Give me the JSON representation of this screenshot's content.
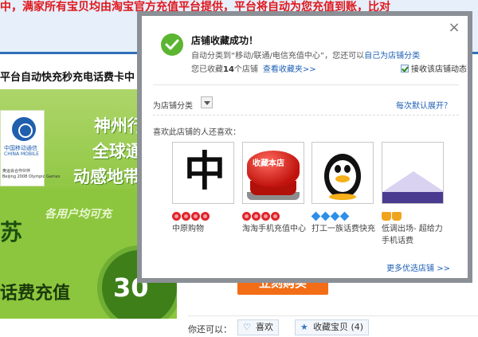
{
  "background": {
    "top_notice": "中，满家所有宝贝均由淘宝官方充值平台提供，平台将自动为您充值到账，比对",
    "product_title": "平台自动快充秒充电话费卡中",
    "banner": {
      "logo_cn": "中国移动通信",
      "logo_en": "CHINA MOBILE",
      "logo_sub1": "奥运会合作伙伴",
      "logo_sub2": "Beijing 2008 Olympic Games",
      "line1": "神州行",
      "line2": "全球通",
      "line3": "动感地带",
      "slogan": "各用户均可充",
      "province": "苏",
      "charge_text": "话费充值",
      "amount": "30"
    },
    "buy_button": "立刻购买",
    "action_label": "你还可以：",
    "like_button": "喜欢",
    "collect_button": "收藏宝贝 (4)"
  },
  "popup": {
    "title": "店铺收藏成功！",
    "auto_class_prefix": "自动分类到",
    "auto_class_name": "“移动/联通/电信充值中心”",
    "auto_class_mid": "，您还可以",
    "auto_class_link": "自己为店铺分类",
    "count_prefix": "您已收藏",
    "count_value": "14",
    "count_suffix": "个店铺",
    "view_link": "查看收藏夹>>",
    "subscribe_label": "接收该店铺动态",
    "category_label": "为店铺分类",
    "expand_link": "每次默认展开？",
    "also_like_title": "喜欢此店铺的人还喜欢：",
    "shops": [
      {
        "name": "中原购物",
        "rating": "heart",
        "count": 4
      },
      {
        "name": "淘淘手机充值中心",
        "rating": "heart",
        "count": 4
      },
      {
        "name": "打工一族话费快充",
        "rating": "diamond",
        "count": 4
      },
      {
        "name": "低调出场- 超给力手机话费",
        "rating": "crown",
        "count": 2
      }
    ],
    "thumb_text": {
      "zhong": "中",
      "red_button": "收藏本店"
    },
    "more_link": "更多优选店铺 >>",
    "close_symbol": "×"
  },
  "colors": {
    "accent_blue": "#1e5fb4",
    "notice_red": "#e0171c",
    "success_green": "#5cb531",
    "buy_orange": "#f36d16"
  }
}
